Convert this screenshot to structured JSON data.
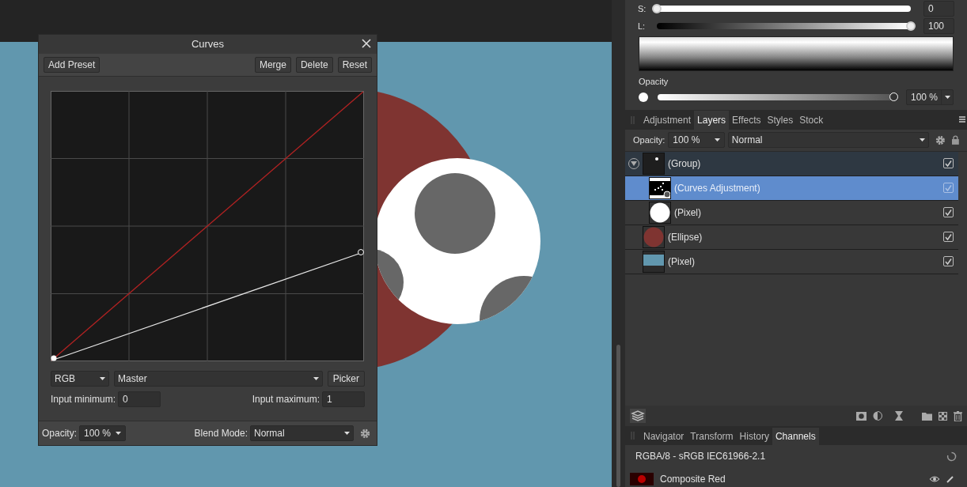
{
  "curves_dialog": {
    "title": "Curves",
    "preset_button": "Add Preset",
    "toolbar_buttons": [
      "Merge",
      "Delete",
      "Reset"
    ],
    "channel_mode": "RGB",
    "channel": "Master",
    "picker_button": "Picker",
    "input_minimum": {
      "label": "Input minimum:",
      "value": "0"
    },
    "input_maximum": {
      "label": "Input maximum:",
      "value": "1"
    },
    "opacity": {
      "label": "Opacity:",
      "value": "100 %"
    },
    "blend_mode": {
      "label": "Blend Mode:",
      "value": "Normal"
    }
  },
  "color_panel": {
    "sliders": [
      {
        "label": "S:",
        "level": 0,
        "value": "0"
      },
      {
        "label": "L:",
        "level": 1,
        "value": "100"
      }
    ],
    "opacity": {
      "label": "Opacity",
      "level": 1,
      "value": "100 %"
    }
  },
  "layers_panel": {
    "tabs": [
      {
        "label": "Adjustment",
        "selected": false
      },
      {
        "label": "Layers",
        "selected": true
      },
      {
        "label": "Effects",
        "selected": false
      },
      {
        "label": "Styles",
        "selected": false
      },
      {
        "label": "Stock",
        "selected": false
      }
    ],
    "opacity": {
      "label": "Opacity:",
      "value": "100 %"
    },
    "blend_mode": "Normal",
    "layers": [
      {
        "name": "(Group)",
        "kind": "group",
        "expanded": true,
        "selected": false,
        "visible": true,
        "children": [
          {
            "name": "(Curves Adjustment)",
            "kind": "adjustment",
            "selected": true,
            "visible": true
          },
          {
            "name": "(Pixel)",
            "kind": "circle-pixel",
            "selected": false,
            "visible": true
          }
        ]
      },
      {
        "name": "(Ellipse)",
        "kind": "ellipse",
        "selected": false,
        "visible": true
      },
      {
        "name": "(Pixel)",
        "kind": "fill-pixel",
        "selected": false,
        "visible": true
      }
    ]
  },
  "channels_panel": {
    "tabs": [
      {
        "label": "Navigator",
        "selected": false
      },
      {
        "label": "Transform",
        "selected": false
      },
      {
        "label": "History",
        "selected": false
      },
      {
        "label": "Channels",
        "selected": true
      }
    ],
    "format": "RGBA/8 - sRGB IEC61966-2.1",
    "channels": [
      {
        "name": "Composite Red"
      }
    ]
  }
}
